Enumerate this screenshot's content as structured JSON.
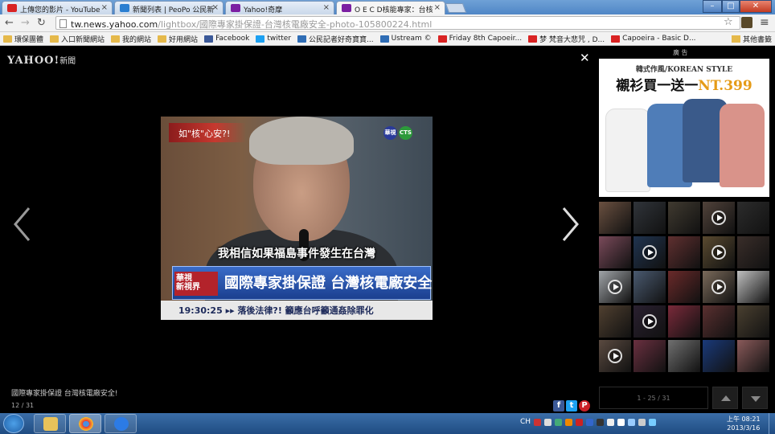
{
  "browser": {
    "tabs": [
      {
        "label": "上傳您的影片 - YouTube",
        "color": "#d92323"
      },
      {
        "label": "新聞列表 | PeoPo 公民新",
        "color": "#2b7fd1"
      },
      {
        "label": "Yahoo!奇摩",
        "color": "#7b1fa2"
      },
      {
        "label": "O E C D核能專家：台核",
        "color": "#7b1fa2"
      }
    ],
    "tab_close_glyph": "×",
    "url_host": "tw.news.yahoo.com",
    "url_path": "/lightbox/國際專家掛保證-台灣核電廠安全-photo-105800224.html",
    "bookmarks": [
      {
        "label": "環保團體",
        "icon": "folder-icon"
      },
      {
        "label": "入口新聞網站",
        "icon": "folder-icon"
      },
      {
        "label": "我的網站",
        "icon": "folder-icon"
      },
      {
        "label": "好用網站",
        "icon": "folder-icon"
      },
      {
        "label": "Facebook",
        "icon": "facebook-icon"
      },
      {
        "label": "twitter",
        "icon": "twitter-icon"
      },
      {
        "label": "公民記者好奇寶寶...",
        "icon": "ustream-icon"
      },
      {
        "label": "Ustream ©",
        "icon": "ustream-icon"
      },
      {
        "label": "Friday 8th Capoeir...",
        "icon": "youtube-icon"
      },
      {
        "label": "梦 梵音大悲咒 , D...",
        "icon": "youtube-icon"
      },
      {
        "label": "Capoeira - Basic D...",
        "icon": "youtube-icon"
      }
    ],
    "other_bookmarks": "其他書籤"
  },
  "lightbox": {
    "logo": "YAHOO!",
    "logo_sub": "新聞",
    "close_glyph": "✕",
    "photo": {
      "tag": "如\"核\"心安?!",
      "channel_badges": [
        "華視",
        "CTS"
      ],
      "subtitle": "我相信如果福島事件發生在台灣",
      "program_badge_line1": "華視",
      "program_badge_line2": "新視界",
      "headline": "國際專家掛保證 台灣核電廠安全!",
      "ticker_time": "19:30:25",
      "ticker_text": "落後法律?! 籲應台呼籲通姦除罪化"
    },
    "caption": "國際專家掛保證 台灣核電廠安全!",
    "counter": "12 / 31",
    "social": [
      {
        "icon": "facebook-icon",
        "glyph": "f",
        "color": "#3b5998"
      },
      {
        "icon": "twitter-icon",
        "glyph": "t",
        "color": "#1da1f2"
      },
      {
        "icon": "pinterest-icon",
        "glyph": "P",
        "color": "#cb2027"
      }
    ],
    "pager": "1 - 25 / 31"
  },
  "ad": {
    "label": "廣  告",
    "title_small": "韓式作風/KOREAN STYLE",
    "title_main": "襯衫買一送一",
    "price": "NT.399",
    "shirt_colors": [
      "#f5f5f5",
      "#4f7db8",
      "#3a5a8a",
      "#d9938a"
    ]
  },
  "thumbnails": [
    {
      "color": "#6a5040",
      "video": false
    },
    {
      "color": "#30343a",
      "video": false
    },
    {
      "color": "#403a30",
      "video": false
    },
    {
      "color": "#50423a",
      "video": true
    },
    {
      "color": "#2c2c2c",
      "video": false
    },
    {
      "color": "#7a4a5a",
      "video": false
    },
    {
      "color": "#203450",
      "video": true
    },
    {
      "color": "#603030",
      "video": false
    },
    {
      "color": "#5a4a30",
      "video": true
    },
    {
      "color": "#3a2e2a",
      "video": false
    },
    {
      "color": "#a0a4a8",
      "video": true
    },
    {
      "color": "#4a5a70",
      "video": false
    },
    {
      "color": "#6a2a2a",
      "video": false
    },
    {
      "color": "#7a6a5a",
      "video": true
    },
    {
      "color": "#c0c0c0",
      "video": false
    },
    {
      "color": "#504030",
      "video": false
    },
    {
      "color": "#2a2030",
      "video": true
    },
    {
      "color": "#7a2a3a",
      "video": false
    },
    {
      "color": "#5a3030",
      "video": false
    },
    {
      "color": "#4a4030",
      "video": false
    },
    {
      "color": "#5a4a40",
      "video": true
    },
    {
      "color": "#6a3040",
      "video": false
    },
    {
      "color": "#707070",
      "video": false
    },
    {
      "color": "#1a3a7a",
      "video": false
    },
    {
      "color": "#8a5a5a",
      "video": false
    }
  ],
  "taskbar": {
    "lang": "CH",
    "time": "上午 08:21",
    "date": "2013/3/16"
  }
}
